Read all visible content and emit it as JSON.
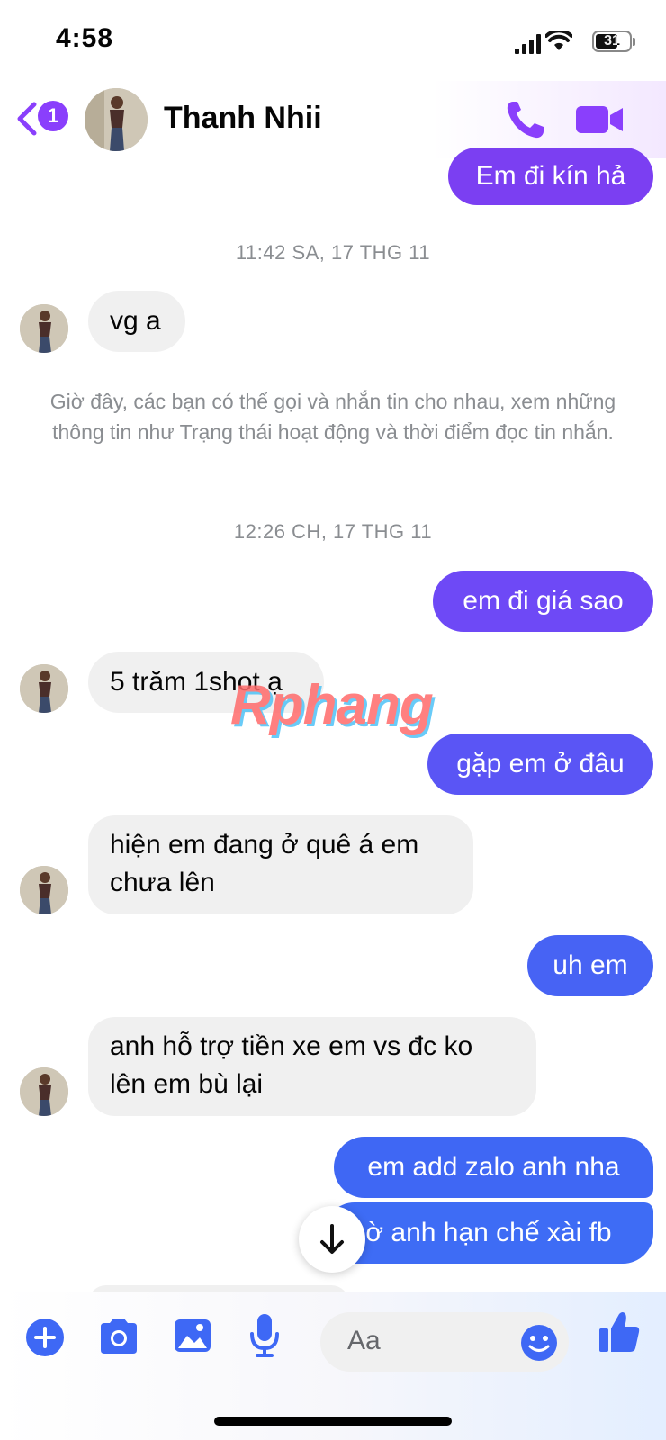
{
  "status": {
    "time": "4:58",
    "battery": "31"
  },
  "header": {
    "back_badge": "1",
    "contact_name": "Thanh Nhii"
  },
  "messages": [
    {
      "text": "Em đi kín hả"
    },
    {
      "timestamp": "11:42 SA, 17 THG 11"
    },
    {
      "text": "vg a"
    },
    {
      "notice": "Giờ đây, các bạn có thể gọi và nhắn tin cho nhau, xem những thông tin như Trạng thái hoạt động và thời điểm đọc tin nhắn."
    },
    {
      "timestamp": "12:26 CH, 17 THG 11"
    },
    {
      "text": "em đi giá sao"
    },
    {
      "text": "5 trăm 1shot ạ"
    },
    {
      "text": "gặp em ở đâu"
    },
    {
      "text": "hiện em đang ở quê á em chưa lên"
    },
    {
      "text": "uh em"
    },
    {
      "text": "anh hỗ trợ tiền xe em vs đc ko lên em bù lại"
    },
    {
      "text": "em add zalo anh nha"
    },
    {
      "text": "ờ anh hạn chế xài fb"
    }
  ],
  "watermark": "Rphang",
  "composer": {
    "placeholder": "Aa"
  },
  "colors": {
    "accent": "#8a3ffc",
    "bubble_purple": "#7b3ff2",
    "bubble_blue": "#3e63f5",
    "incoming": "#f0f0f0"
  }
}
